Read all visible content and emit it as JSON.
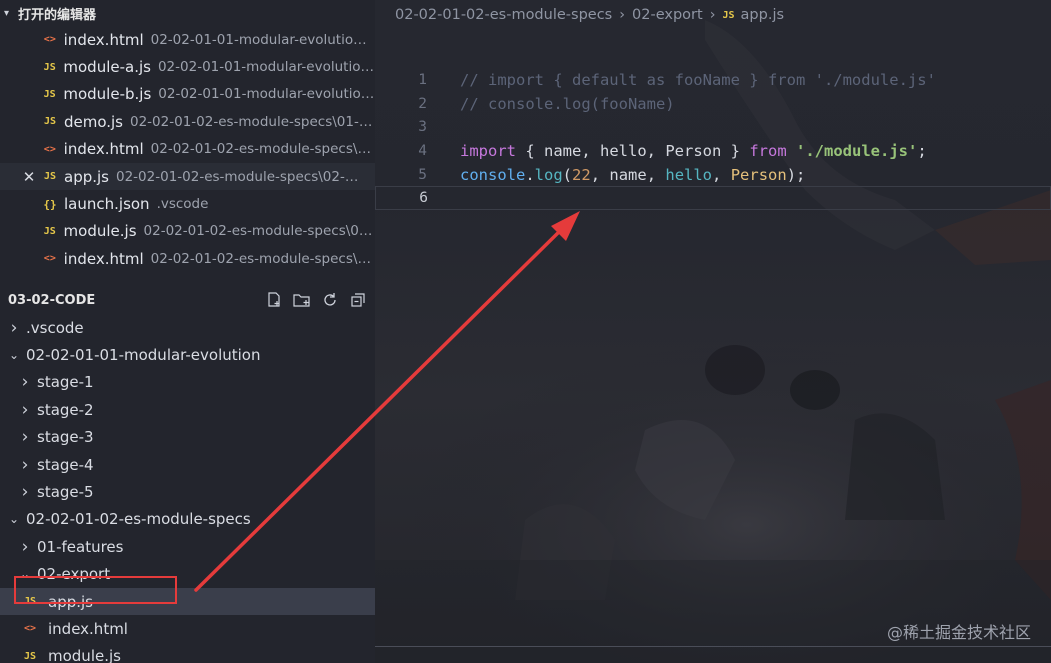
{
  "open_editors": {
    "title": "打开的编辑器",
    "files": [
      {
        "icon": "html",
        "name": "index.html",
        "desc": "02-02-01-01-modular-evolution\\..."
      },
      {
        "icon": "js",
        "name": "module-a.js",
        "desc": "02-02-01-01-modular-evolution..."
      },
      {
        "icon": "js",
        "name": "module-b.js",
        "desc": "02-02-01-01-modular-evolution..."
      },
      {
        "icon": "js",
        "name": "demo.js",
        "desc": "02-02-01-02-es-module-specs\\01-fe..."
      },
      {
        "icon": "html",
        "name": "index.html",
        "desc": "02-02-01-02-es-module-specs\\0..."
      },
      {
        "icon": "js",
        "name": "app.js",
        "desc": "02-02-01-02-es-module-specs\\02-exp..."
      },
      {
        "icon": "json",
        "name": "launch.json",
        "desc": ".vscode"
      },
      {
        "icon": "js",
        "name": "module.js",
        "desc": "02-02-01-02-es-module-specs\\02..."
      },
      {
        "icon": "html",
        "name": "index.html",
        "desc": "02-02-01-02-es-module-specs\\0..."
      }
    ]
  },
  "project": {
    "title": "03-02-CODE",
    "tree": [
      {
        "indent": 0,
        "twisty": ">",
        "label": ".vscode"
      },
      {
        "indent": 0,
        "twisty": "v",
        "label": "02-02-01-01-modular-evolution"
      },
      {
        "indent": 1,
        "twisty": ">",
        "label": "stage-1"
      },
      {
        "indent": 1,
        "twisty": ">",
        "label": "stage-2"
      },
      {
        "indent": 1,
        "twisty": ">",
        "label": "stage-3"
      },
      {
        "indent": 1,
        "twisty": ">",
        "label": "stage-4"
      },
      {
        "indent": 1,
        "twisty": ">",
        "label": "stage-5"
      },
      {
        "indent": 0,
        "twisty": "v",
        "label": "02-02-01-02-es-module-specs"
      },
      {
        "indent": 1,
        "twisty": ">",
        "label": "01-features"
      },
      {
        "indent": 1,
        "twisty": "v",
        "label": "02-export"
      },
      {
        "indent": 2,
        "icon": "js",
        "label": "app.js"
      },
      {
        "indent": 2,
        "icon": "html",
        "label": "index.html"
      },
      {
        "indent": 2,
        "icon": "js",
        "label": "module.js"
      }
    ]
  },
  "icons": {
    "js": "JS",
    "html": "<>",
    "json": "{}"
  },
  "breadcrumb": {
    "part1": "02-02-01-02-es-module-specs",
    "part2": "02-export",
    "file_icon": "JS",
    "file": "app.js"
  },
  "code_lines": [
    {
      "n": "1",
      "tokens": [
        [
          "cm",
          "// import { default as fooName } from './module.js'"
        ]
      ]
    },
    {
      "n": "2",
      "tokens": [
        [
          "cm",
          "// console.log(fooName)"
        ]
      ]
    },
    {
      "n": "3",
      "tokens": []
    },
    {
      "n": "4",
      "tokens": [
        [
          "kw",
          "import"
        ],
        [
          "pt",
          " { "
        ],
        [
          "id",
          "name"
        ],
        [
          "pt",
          ", "
        ],
        [
          "id",
          "hello"
        ],
        [
          "pt",
          ", "
        ],
        [
          "id",
          "Person"
        ],
        [
          "pt",
          " } "
        ],
        [
          "kw",
          "from"
        ],
        [
          "pt",
          " "
        ],
        [
          "st",
          "'./module.js'"
        ],
        [
          "pt",
          ";"
        ]
      ]
    },
    {
      "n": "5",
      "tokens": [
        [
          "ob",
          "console"
        ],
        [
          "pt",
          "."
        ],
        [
          "fn",
          "log"
        ],
        [
          "pt",
          "("
        ],
        [
          "nm",
          "22"
        ],
        [
          "pt",
          ", "
        ],
        [
          "id",
          "name"
        ],
        [
          "pt",
          ", "
        ],
        [
          "fn",
          "hello"
        ],
        [
          "pt",
          ", "
        ],
        [
          "cl",
          "Person"
        ],
        [
          "pt",
          ");"
        ]
      ]
    },
    {
      "n": "6",
      "tokens": []
    }
  ],
  "watermark": "@稀土掘金技术社区",
  "colors": {
    "annotation_red": "#e53b3b",
    "js_icon": "#e6c84a",
    "html_icon": "#e8734a"
  }
}
